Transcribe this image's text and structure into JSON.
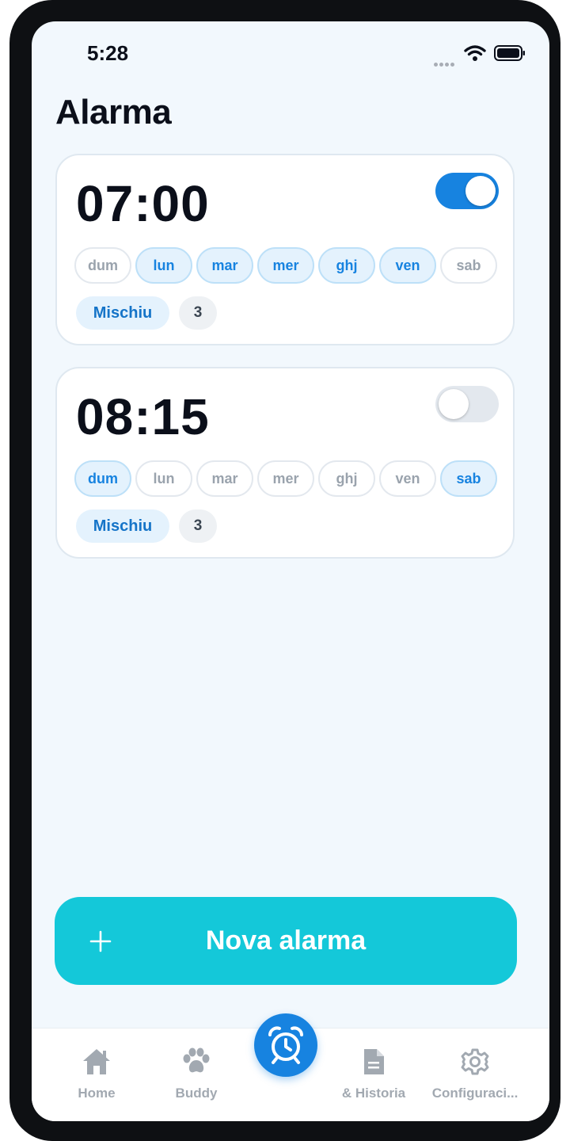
{
  "status_bar": {
    "time": "5:28"
  },
  "header": {
    "title": "Alarma"
  },
  "alarms": [
    {
      "time": "07:00",
      "enabled": true,
      "days": [
        {
          "label": "dum",
          "active": false
        },
        {
          "label": "lun",
          "active": true
        },
        {
          "label": "mar",
          "active": true
        },
        {
          "label": "mer",
          "active": true
        },
        {
          "label": "ghj",
          "active": true
        },
        {
          "label": "ven",
          "active": true
        },
        {
          "label": "sab",
          "active": false
        }
      ],
      "tag": "Mischiu",
      "count": "3"
    },
    {
      "time": "08:15",
      "enabled": false,
      "days": [
        {
          "label": "dum",
          "active": true
        },
        {
          "label": "lun",
          "active": false
        },
        {
          "label": "mar",
          "active": false
        },
        {
          "label": "mer",
          "active": false
        },
        {
          "label": "ghj",
          "active": false
        },
        {
          "label": "ven",
          "active": false
        },
        {
          "label": "sab",
          "active": true
        }
      ],
      "tag": "Mischiu",
      "count": "3"
    }
  ],
  "new_alarm_button": {
    "label": "Nova alarma",
    "icon": "plus-icon"
  },
  "tab_bar": {
    "items": [
      {
        "label": "Home",
        "icon": "home-icon"
      },
      {
        "label": "Buddy",
        "icon": "paw-icon"
      },
      {
        "label": "",
        "icon": "alarm-clock-icon",
        "selected": true
      },
      {
        "label": "& Historia",
        "icon": "document-icon"
      },
      {
        "label": "Configuraci...",
        "icon": "gear-icon"
      }
    ]
  },
  "colors": {
    "accent": "#1783e0",
    "button": "#14c8d9",
    "background": "#f2f8fd",
    "text": "#0b0f1a"
  }
}
